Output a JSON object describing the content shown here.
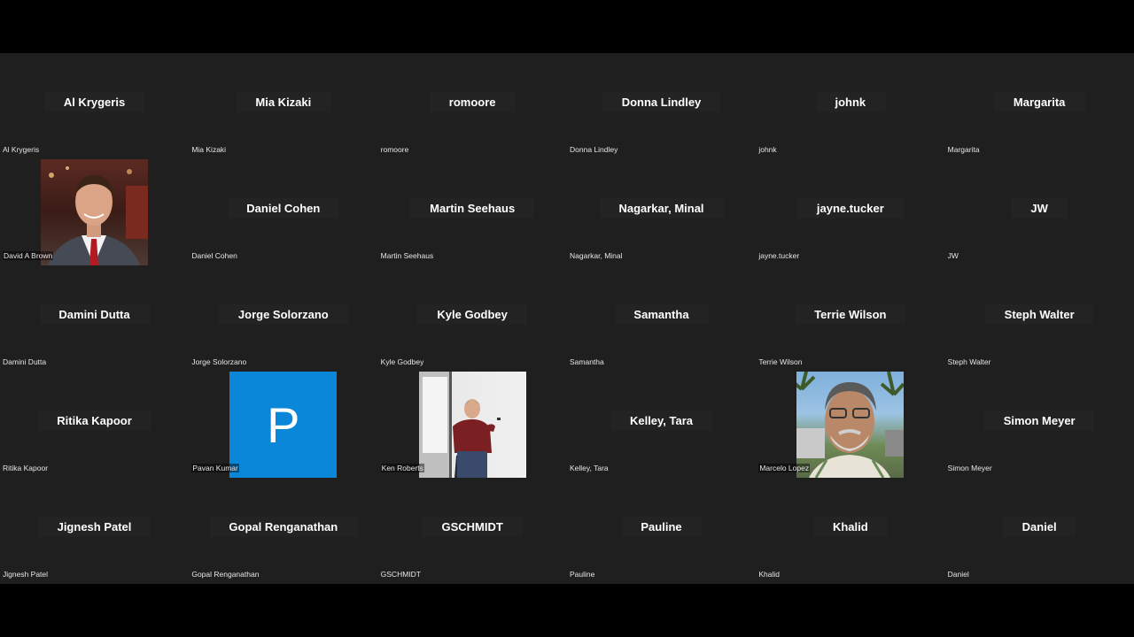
{
  "participants": [
    {
      "display": "Al Krygeris",
      "label": "Al Krygeris",
      "type": "name"
    },
    {
      "display": "Mia Kizaki",
      "label": "Mia Kizaki",
      "type": "name"
    },
    {
      "display": "romoore",
      "label": "romoore",
      "type": "name"
    },
    {
      "display": "Donna Lindley",
      "label": "Donna Lindley",
      "type": "name"
    },
    {
      "display": "johnk",
      "label": "johnk",
      "type": "name"
    },
    {
      "display": "Margarita",
      "label": "Margarita",
      "type": "name"
    },
    {
      "display": "",
      "label": "David A Brown",
      "type": "video",
      "video": "david"
    },
    {
      "display": "Daniel Cohen",
      "label": "Daniel Cohen",
      "type": "name"
    },
    {
      "display": "Martin Seehaus",
      "label": "Martin Seehaus",
      "type": "name"
    },
    {
      "display": "Nagarkar, Minal",
      "label": "Nagarkar, Minal",
      "type": "name"
    },
    {
      "display": "jayne.tucker",
      "label": "jayne.tucker",
      "type": "name"
    },
    {
      "display": "JW",
      "label": "JW",
      "type": "name"
    },
    {
      "display": "Damini Dutta",
      "label": "Damini Dutta",
      "type": "name"
    },
    {
      "display": "Jorge Solorzano",
      "label": "Jorge Solorzano",
      "type": "name"
    },
    {
      "display": "Kyle Godbey",
      "label": "Kyle Godbey",
      "type": "name"
    },
    {
      "display": "Samantha",
      "label": "Samantha",
      "type": "name"
    },
    {
      "display": "Terrie Wilson",
      "label": "Terrie Wilson",
      "type": "name"
    },
    {
      "display": "Steph Walter",
      "label": "Steph Walter",
      "type": "name"
    },
    {
      "display": "Ritika Kapoor",
      "label": "Ritika Kapoor",
      "type": "name"
    },
    {
      "display": "",
      "label": "Pavan Kumar",
      "type": "video",
      "video": "pavan",
      "avatar_letter": "P"
    },
    {
      "display": "",
      "label": "Ken Roberts",
      "type": "video",
      "video": "ken"
    },
    {
      "display": "Kelley, Tara",
      "label": "Kelley, Tara",
      "type": "name"
    },
    {
      "display": "",
      "label": "Marcelo Lopez",
      "type": "video",
      "video": "marcelo"
    },
    {
      "display": "Simon Meyer",
      "label": "Simon Meyer",
      "type": "name"
    },
    {
      "display": "Jignesh Patel",
      "label": "Jignesh Patel",
      "type": "name"
    },
    {
      "display": "Gopal Renganathan",
      "label": "Gopal Renganathan",
      "type": "name"
    },
    {
      "display": "GSCHMIDT",
      "label": "GSCHMIDT",
      "type": "name"
    },
    {
      "display": "Pauline",
      "label": "Pauline",
      "type": "name"
    },
    {
      "display": "Khalid",
      "label": "Khalid",
      "type": "name"
    },
    {
      "display": "Daniel",
      "label": "Daniel",
      "type": "name"
    }
  ],
  "colors": {
    "grid_bg": "#1f1f1f",
    "avatar_blue": "#0a87d8"
  }
}
